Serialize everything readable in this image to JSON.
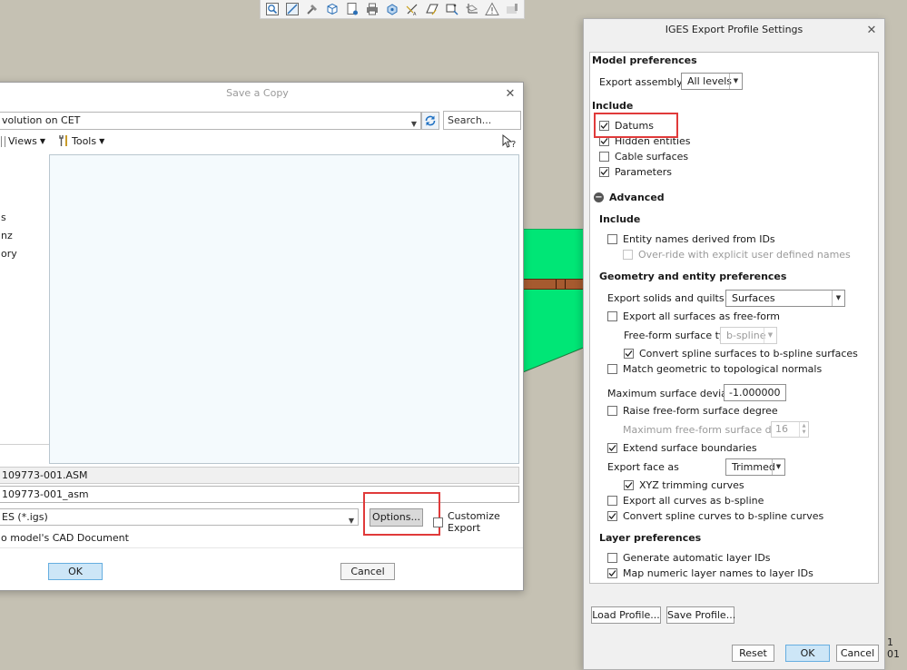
{
  "toolbar": {
    "icons": [
      "zoom-fit-icon",
      "sketch-plane-icon",
      "hammer-icon",
      "cube-icon",
      "page-orient-icon",
      "printer-icon",
      "spin-center-icon",
      "datum-axes-icon",
      "datum-plane-icon",
      "datum-points-icon",
      "csys-icon",
      "warning-icon"
    ]
  },
  "save_dialog": {
    "title": "Save a Copy",
    "path_fragment": "volution on CET",
    "search_placeholder": "Search...",
    "views_label": "Views",
    "tools_label": "Tools",
    "nav_fragments": [
      "s",
      "nz",
      "ory"
    ],
    "current_name_fragment": "109773-001.ASM",
    "new_name_fragment": "109773-001_asm",
    "type_fragment": "ES (*.igs)",
    "options_label": "Options...",
    "customize_label": "Customize Export",
    "cad_fragment": "o model's CAD Document",
    "ok_label": "OK",
    "cancel_label": "Cancel"
  },
  "iges": {
    "title": "IGES Export Profile Settings",
    "model_prefs_heading": "Model preferences",
    "export_assembly_label": "Export assembly as",
    "export_assembly_value": "All levels",
    "include_heading": "Include",
    "datums": "Datums",
    "hidden_entities": "Hidden entities",
    "cable_surfaces": "Cable surfaces",
    "parameters": "Parameters",
    "advanced_heading": "Advanced",
    "adv_include_heading": "Include",
    "entity_names": "Entity names derived from IDs",
    "override_names": "Over-ride with explicit user defined names",
    "geometry_heading": "Geometry and entity preferences",
    "export_solids_label": "Export solids and quilts as",
    "export_solids_value": "Surfaces",
    "export_all_surfaces": "Export all surfaces as free-form",
    "freeform_type_label": "Free-form surface type",
    "freeform_type_value": "b-spline",
    "convert_spline_surfaces": "Convert spline surfaces to b-spline surfaces",
    "match_normals": "Match geometric to topological normals",
    "max_deviation_label": "Maximum surface deviation",
    "max_deviation_value": "-1.000000",
    "raise_degree": "Raise free-form surface degree",
    "max_degree_label": "Maximum free-form surface degree",
    "max_degree_value": "16",
    "extend_boundaries": "Extend surface boundaries",
    "export_face_label": "Export face as",
    "export_face_value": "Trimmed",
    "xyz_trimming": "XYZ trimming curves",
    "export_curves_bspline": "Export all curves as b-spline",
    "convert_spline_curves": "Convert spline curves to b-spline curves",
    "layer_heading": "Layer preferences",
    "generate_layer_ids": "Generate automatic layer IDs",
    "map_layer_names": "Map numeric layer names to layer IDs",
    "load_profile": "Load Profile...",
    "save_profile": "Save Profile...",
    "reset": "Reset",
    "ok": "OK",
    "cancel": "Cancel"
  },
  "side_fragment": {
    "line1": "1",
    "line2": "01"
  },
  "colors": {
    "model_green": "#00e676",
    "model_stripe": "#a65a2f",
    "highlight_red": "#e03a3a",
    "default_button": "#cde6f7",
    "background": "#c5c1b3"
  }
}
